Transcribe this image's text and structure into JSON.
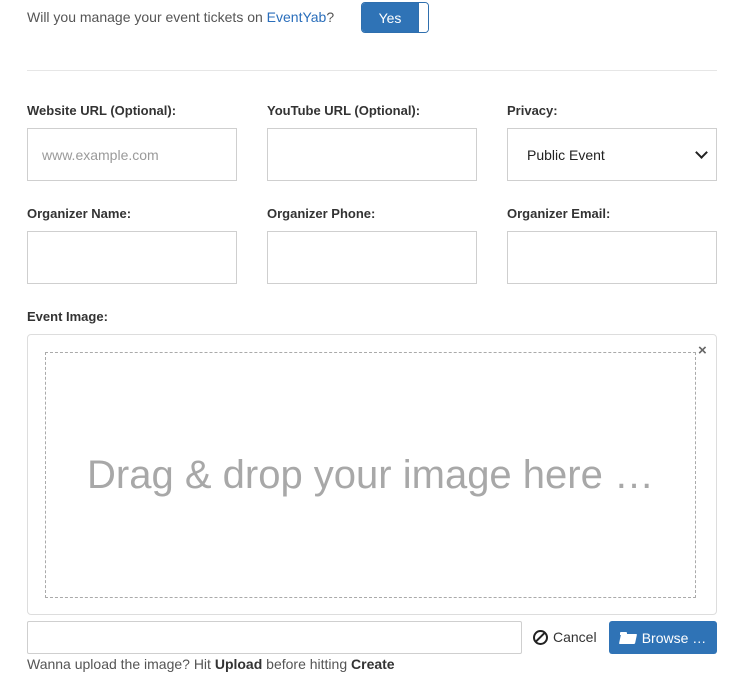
{
  "manage_question": {
    "prefix": "Will you manage your event tickets on ",
    "link": "EventYab",
    "suffix": "?",
    "toggle_label": "Yes"
  },
  "fields": {
    "website_label": "Website URL (Optional):",
    "website_placeholder": "www.example.com",
    "youtube_label": "YouTube URL (Optional):",
    "privacy_label": "Privacy:",
    "privacy_value": "Public Event",
    "organizer_name_label": "Organizer Name:",
    "organizer_phone_label": "Organizer Phone:",
    "organizer_email_label": "Organizer Email:"
  },
  "image_upload": {
    "label": "Event Image:",
    "drop_text": "Drag & drop your image here …",
    "close_symbol": "×",
    "cancel_label": "Cancel",
    "browse_label": "Browse …",
    "hint_prefix": "Wanna upload the image? Hit ",
    "hint_upload": "Upload",
    "hint_middle": " before hitting ",
    "hint_create": "Create"
  }
}
